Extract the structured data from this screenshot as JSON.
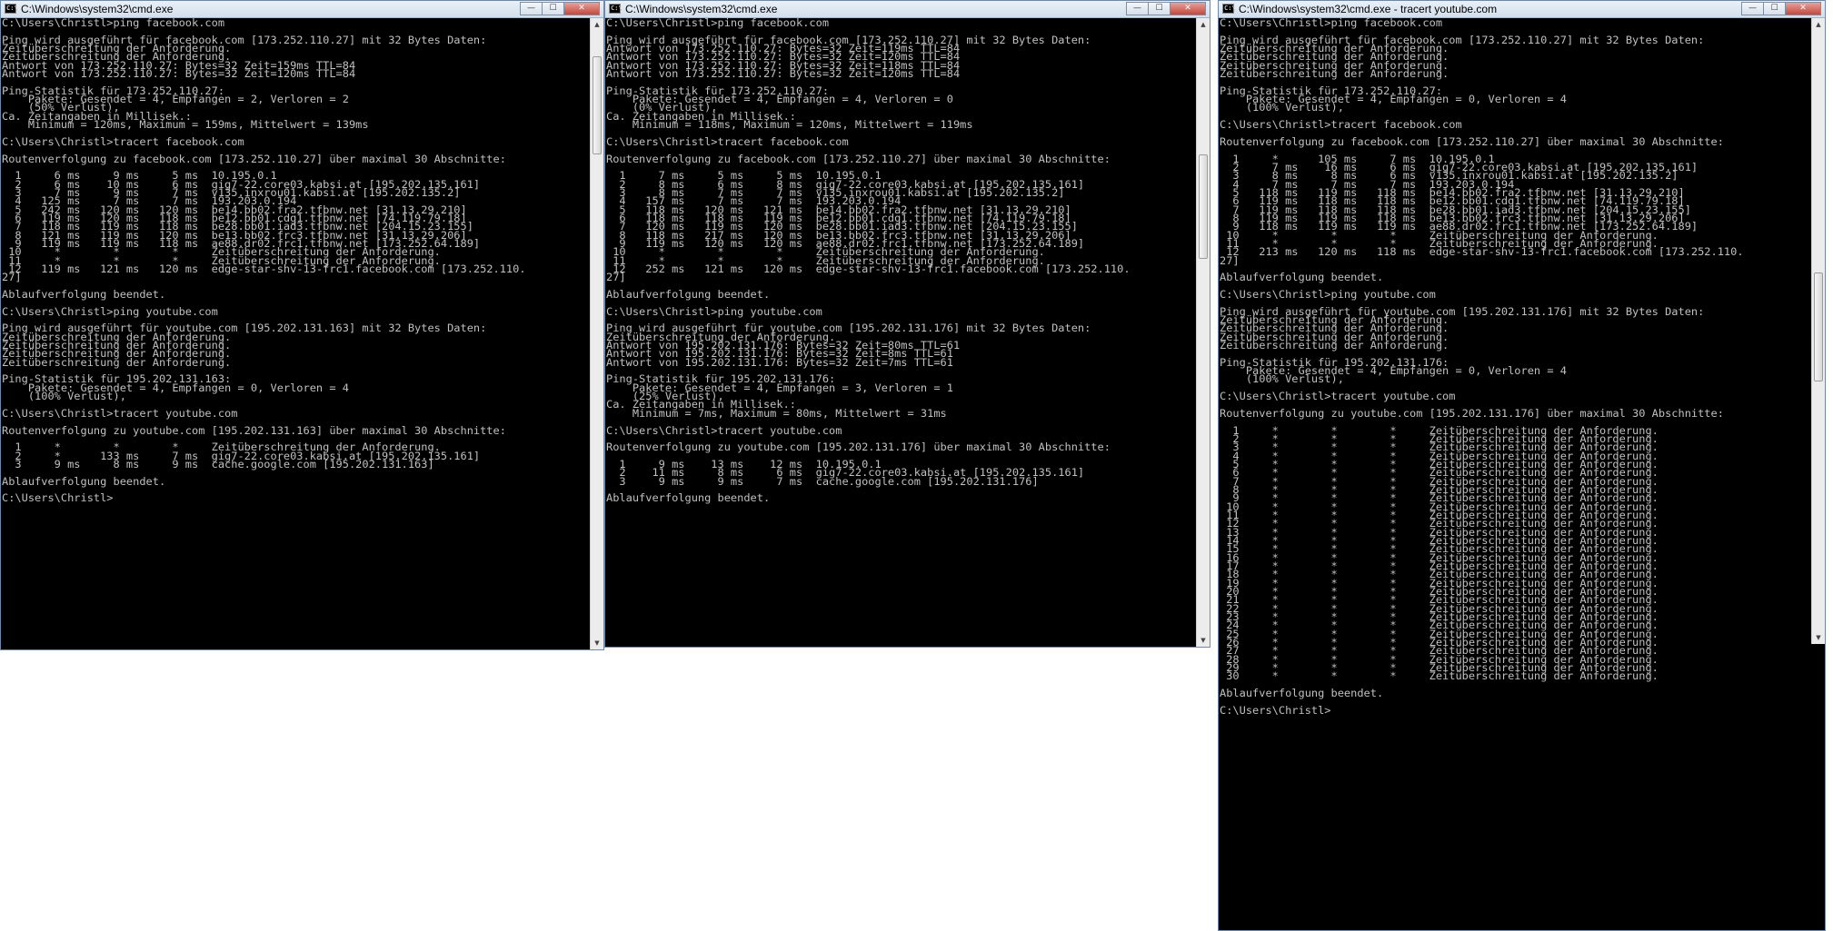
{
  "windows": [
    {
      "title": "C:\\Windows\\system32\\cmd.exe",
      "icon": "cmd-icon",
      "controls": {
        "minimize": "—",
        "maximize": "☐",
        "close": "✕"
      },
      "lines": [
        "C:\\Users\\Christl>ping facebook.com",
        "",
        "Ping wird ausgeführt für facebook.com [173.252.110.27] mit 32 Bytes Daten:",
        "Zeitüberschreitung der Anforderung.",
        "Zeitüberschreitung der Anforderung.",
        "Antwort von 173.252.110.27: Bytes=32 Zeit=159ms TTL=84",
        "Antwort von 173.252.110.27: Bytes=32 Zeit=120ms TTL=84",
        "",
        "Ping-Statistik für 173.252.110.27:",
        "    Pakete: Gesendet = 4, Empfangen = 2, Verloren = 2",
        "    (50% Verlust),",
        "Ca. Zeitangaben in Millisek.:",
        "    Minimum = 120ms, Maximum = 159ms, Mittelwert = 139ms",
        "",
        "C:\\Users\\Christl>tracert facebook.com",
        "",
        "Routenverfolgung zu facebook.com [173.252.110.27] über maximal 30 Abschnitte:",
        "",
        "  1     6 ms     9 ms     5 ms  10.195.0.1",
        "  2     6 ms    10 ms     6 ms  gig7-22.core03.kabsi.at [195.202.135.161]",
        "  3     7 ms     9 ms     7 ms  v135.inxrou01.kabsi.at [195.202.135.2]",
        "  4   125 ms     7 ms     7 ms  193.203.0.194",
        "  5   242 ms   120 ms   120 ms  be14.bb02.fra2.tfbnw.net [31.13.29.210]",
        "  6   119 ms   120 ms   118 ms  be12.bb01.cdg1.tfbnw.net [74.119.79.18]",
        "  7   118 ms   119 ms   118 ms  be28.bb01.iad3.tfbnw.net [204.15.23.155]",
        "  8   121 ms   119 ms   120 ms  be13.bb02.frc3.tfbnw.net [31.13.29.206]",
        "  9   119 ms   119 ms   118 ms  ae88.dr02.frc1.tfbnw.net [173.252.64.189]",
        " 10     *        *        *     Zeitüberschreitung der Anforderung.",
        " 11     *        *        *     Zeitüberschreitung der Anforderung.",
        " 12   119 ms   121 ms   120 ms  edge-star-shv-13-frc1.facebook.com [173.252.110.",
        "27]",
        "",
        "Ablaufverfolgung beendet.",
        "",
        "C:\\Users\\Christl>ping youtube.com",
        "",
        "Ping wird ausgeführt für youtube.com [195.202.131.163] mit 32 Bytes Daten:",
        "Zeitüberschreitung der Anforderung.",
        "Zeitüberschreitung der Anforderung.",
        "Zeitüberschreitung der Anforderung.",
        "Zeitüberschreitung der Anforderung.",
        "",
        "Ping-Statistik für 195.202.131.163:",
        "    Pakete: Gesendet = 4, Empfangen = 0, Verloren = 4",
        "    (100% Verlust),",
        "",
        "C:\\Users\\Christl>tracert youtube.com",
        "",
        "Routenverfolgung zu youtube.com [195.202.131.163] über maximal 30 Abschnitte:",
        "",
        "  1     *        *        *     Zeitüberschreitung der Anforderung.",
        "  2     *      133 ms     7 ms  gig7-22.core03.kabsi.at [195.202.135.161]",
        "  3     9 ms     8 ms     9 ms  cache.google.com [195.202.131.163]",
        "",
        "Ablaufverfolgung beendet.",
        "",
        "C:\\Users\\Christl>"
      ]
    },
    {
      "title": "C:\\Windows\\system32\\cmd.exe",
      "icon": "cmd-icon",
      "controls": {
        "minimize": "—",
        "maximize": "☐",
        "close": "✕"
      },
      "lines": [
        "C:\\Users\\Christl>ping facebook.com",
        "",
        "Ping wird ausgeführt für facebook.com [173.252.110.27] mit 32 Bytes Daten:",
        "Antwort von 173.252.110.27: Bytes=32 Zeit=119ms TTL=84",
        "Antwort von 173.252.110.27: Bytes=32 Zeit=120ms TTL=84",
        "Antwort von 173.252.110.27: Bytes=32 Zeit=118ms TTL=84",
        "Antwort von 173.252.110.27: Bytes=32 Zeit=120ms TTL=84",
        "",
        "Ping-Statistik für 173.252.110.27:",
        "    Pakete: Gesendet = 4, Empfangen = 4, Verloren = 0",
        "    (0% Verlust),",
        "Ca. Zeitangaben in Millisek.:",
        "    Minimum = 118ms, Maximum = 120ms, Mittelwert = 119ms",
        "",
        "C:\\Users\\Christl>tracert facebook.com",
        "",
        "Routenverfolgung zu facebook.com [173.252.110.27] über maximal 30 Abschnitte:",
        "",
        "  1     7 ms     5 ms     5 ms  10.195.0.1",
        "  2     8 ms     6 ms     8 ms  gig7-22.core03.kabsi.at [195.202.135.161]",
        "  3     8 ms     7 ms     7 ms  v135.inxrou01.kabsi.at [195.202.135.2]",
        "  4   157 ms     7 ms     7 ms  193.203.0.194",
        "  5   118 ms   120 ms   121 ms  be14.bb02.fra2.tfbnw.net [31.13.29.210]",
        "  6   118 ms   118 ms   119 ms  be12.bb01.cdg1.tfbnw.net [74.119.79.18]",
        "  7   120 ms   119 ms   120 ms  be28.bb01.iad3.tfbnw.net [204.15.23.155]",
        "  8   118 ms   217 ms   120 ms  be13.bb02.frc3.tfbnw.net [31.13.29.206]",
        "  9   119 ms   120 ms   120 ms  ae88.dr02.frc1.tfbnw.net [173.252.64.189]",
        " 10     *        *        *     Zeitüberschreitung der Anforderung.",
        " 11     *        *        *     Zeitüberschreitung der Anforderung.",
        " 12   252 ms   121 ms   120 ms  edge-star-shv-13-frc1.facebook.com [173.252.110.",
        "27]",
        "",
        "Ablaufverfolgung beendet.",
        "",
        "C:\\Users\\Christl>ping youtube.com",
        "",
        "Ping wird ausgeführt für youtube.com [195.202.131.176] mit 32 Bytes Daten:",
        "Zeitüberschreitung der Anforderung.",
        "Antwort von 195.202.131.176: Bytes=32 Zeit=80ms TTL=61",
        "Antwort von 195.202.131.176: Bytes=32 Zeit=8ms TTL=61",
        "Antwort von 195.202.131.176: Bytes=32 Zeit=7ms TTL=61",
        "",
        "Ping-Statistik für 195.202.131.176:",
        "    Pakete: Gesendet = 4, Empfangen = 3, Verloren = 1",
        "    (25% Verlust),",
        "Ca. Zeitangaben in Millisek.:",
        "    Minimum = 7ms, Maximum = 80ms, Mittelwert = 31ms",
        "",
        "C:\\Users\\Christl>tracert youtube.com",
        "",
        "Routenverfolgung zu youtube.com [195.202.131.176] über maximal 30 Abschnitte:",
        "",
        "  1     9 ms    13 ms    12 ms  10.195.0.1",
        "  2    11 ms     8 ms     6 ms  gig7-22.core03.kabsi.at [195.202.135.161]",
        "  3     9 ms     9 ms     7 ms  cache.google.com [195.202.131.176]",
        "",
        "Ablaufverfolgung beendet."
      ]
    },
    {
      "title": "C:\\Windows\\system32\\cmd.exe - tracert  youtube.com",
      "icon": "cmd-icon",
      "controls": {
        "minimize": "—",
        "maximize": "☐",
        "close": "✕"
      },
      "lines": [
        "C:\\Users\\Christl>ping facebook.com",
        "",
        "Ping wird ausgeführt für facebook.com [173.252.110.27] mit 32 Bytes Daten:",
        "Zeitüberschreitung der Anforderung.",
        "Zeitüberschreitung der Anforderung.",
        "Zeitüberschreitung der Anforderung.",
        "Zeitüberschreitung der Anforderung.",
        "",
        "Ping-Statistik für 173.252.110.27:",
        "    Pakete: Gesendet = 4, Empfangen = 0, Verloren = 4",
        "    (100% Verlust),",
        "",
        "C:\\Users\\Christl>tracert facebook.com",
        "",
        "Routenverfolgung zu facebook.com [173.252.110.27] über maximal 30 Abschnitte:",
        "",
        "  1     *      105 ms     7 ms  10.195.0.1",
        "  2     7 ms    16 ms     6 ms  gig7-22.core03.kabsi.at [195.202.135.161]",
        "  3     8 ms     8 ms     6 ms  v135.inxrou01.kabsi.at [195.202.135.2]",
        "  4     7 ms     7 ms     7 ms  193.203.0.194",
        "  5   118 ms   119 ms   118 ms  be14.bb02.fra2.tfbnw.net [31.13.29.210]",
        "  6   119 ms   118 ms   118 ms  be12.bb01.cdg1.tfbnw.net [74.119.79.18]",
        "  7   119 ms   118 ms   118 ms  be28.bb01.iad3.tfbnw.net [204.15.23.155]",
        "  8   119 ms   119 ms   118 ms  be13.bb02.frc3.tfbnw.net [31.13.29.206]",
        "  9   118 ms   119 ms   119 ms  ae88.dr02.frc1.tfbnw.net [173.252.64.189]",
        " 10     *        *        *     Zeitüberschreitung der Anforderung.",
        " 11     *        *        *     Zeitüberschreitung der Anforderung.",
        " 12   213 ms   120 ms   118 ms  edge-star-shv-13-frc1.facebook.com [173.252.110.",
        "27]",
        "",
        "Ablaufverfolgung beendet.",
        "",
        "C:\\Users\\Christl>ping youtube.com",
        "",
        "Ping wird ausgeführt für youtube.com [195.202.131.176] mit 32 Bytes Daten:",
        "Zeitüberschreitung der Anforderung.",
        "Zeitüberschreitung der Anforderung.",
        "Zeitüberschreitung der Anforderung.",
        "Zeitüberschreitung der Anforderung.",
        "",
        "Ping-Statistik für 195.202.131.176:",
        "    Pakete: Gesendet = 4, Empfangen = 0, Verloren = 4",
        "    (100% Verlust),",
        "",
        "C:\\Users\\Christl>tracert youtube.com",
        "",
        "Routenverfolgung zu youtube.com [195.202.131.176] über maximal 30 Abschnitte:",
        "",
        "  1     *        *        *     Zeitüberschreitung der Anforderung.",
        "  2     *        *        *     Zeitüberschreitung der Anforderung.",
        "  3     *        *        *     Zeitüberschreitung der Anforderung.",
        "  4     *        *        *     Zeitüberschreitung der Anforderung.",
        "  5     *        *        *     Zeitüberschreitung der Anforderung.",
        "  6     *        *        *     Zeitüberschreitung der Anforderung.",
        "  7     *        *        *     Zeitüberschreitung der Anforderung.",
        "  8     *        *        *     Zeitüberschreitung der Anforderung.",
        "  9     *        *        *     Zeitüberschreitung der Anforderung.",
        " 10     *        *        *     Zeitüberschreitung der Anforderung.",
        " 11     *        *        *     Zeitüberschreitung der Anforderung.",
        " 12     *        *        *     Zeitüberschreitung der Anforderung.",
        " 13     *        *        *     Zeitüberschreitung der Anforderung.",
        " 14     *        *        *     Zeitüberschreitung der Anforderung.",
        " 15     *        *        *     Zeitüberschreitung der Anforderung.",
        " 16     *        *        *     Zeitüberschreitung der Anforderung.",
        " 17     *        *        *     Zeitüberschreitung der Anforderung.",
        " 18     *        *        *     Zeitüberschreitung der Anforderung.",
        " 19     *        *        *     Zeitüberschreitung der Anforderung.",
        " 20     *        *        *     Zeitüberschreitung der Anforderung.",
        " 21     *        *        *     Zeitüberschreitung der Anforderung.",
        " 22     *        *        *     Zeitüberschreitung der Anforderung.",
        " 23     *        *        *     Zeitüberschreitung der Anforderung.",
        " 24     *        *        *     Zeitüberschreitung der Anforderung.",
        " 25     *        *        *     Zeitüberschreitung der Anforderung.",
        " 26     *        *        *     Zeitüberschreitung der Anforderung.",
        " 27     *        *        *     Zeitüberschreitung der Anforderung.",
        " 28     *        *        *     Zeitüberschreitung der Anforderung.",
        " 29     *        *        *     Zeitüberschreitung der Anforderung.",
        " 30     *        *        *     Zeitüberschreitung der Anforderung.",
        "",
        "Ablaufverfolgung beendet.",
        "",
        "C:\\Users\\Christl>"
      ]
    }
  ]
}
